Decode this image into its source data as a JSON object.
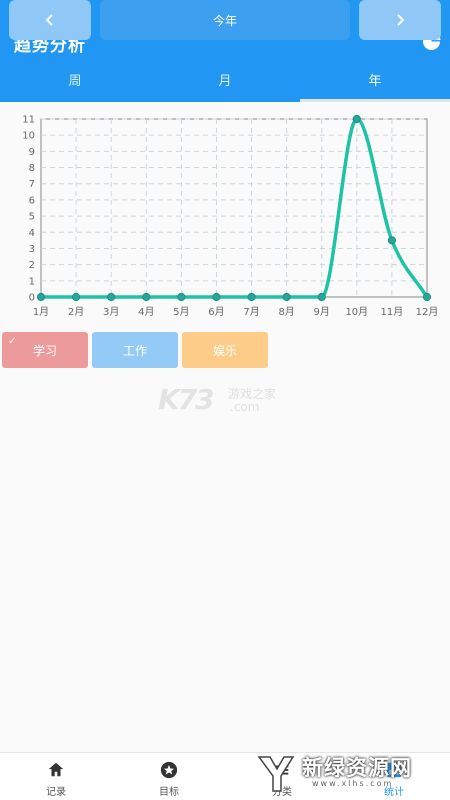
{
  "header": {
    "title": "趋势分析",
    "action_icon": "pie-chart-icon"
  },
  "tabs": [
    {
      "label": "周",
      "active": false
    },
    {
      "label": "月",
      "active": false
    },
    {
      "label": "年",
      "active": true
    }
  ],
  "chart_data": {
    "type": "line",
    "categories": [
      "1月",
      "2月",
      "3月",
      "4月",
      "5月",
      "6月",
      "7月",
      "8月",
      "9月",
      "10月",
      "11月",
      "12月"
    ],
    "series": [
      {
        "values": [
          0,
          0,
          0,
          0,
          0,
          0,
          0,
          0,
          0,
          11,
          3.5,
          0
        ],
        "color": "#1ec3a6"
      }
    ],
    "y_ticks": [
      "0",
      "1",
      "2",
      "3",
      "4",
      "5",
      "6",
      "7",
      "8",
      "9",
      "10",
      "11"
    ],
    "ylim": [
      0,
      11
    ],
    "grid": true,
    "smooth": true
  },
  "categories": [
    {
      "label": "学习",
      "color": "#ec9a9a",
      "selected": true,
      "check": "✓"
    },
    {
      "label": "工作",
      "color": "#94cbf6",
      "selected": false
    },
    {
      "label": "娱乐",
      "color": "#fccc88",
      "selected": false
    }
  ],
  "watermark": {
    "logo": "K73",
    "line1": "游戏之家",
    "line2": ".com"
  },
  "period_nav": {
    "prev": "‹",
    "current": "今年",
    "next": "›"
  },
  "bottom_nav": [
    {
      "label": "记录",
      "icon": "home-icon",
      "active": false
    },
    {
      "label": "目标",
      "icon": "star-circle-icon",
      "active": false
    },
    {
      "label": "分类",
      "icon": "list-icon",
      "active": false
    },
    {
      "label": "统计",
      "icon": "chart-icon",
      "active": true
    }
  ],
  "brand_overlay": {
    "text": "新绿资源网",
    "url": "www.xlhs.com"
  }
}
